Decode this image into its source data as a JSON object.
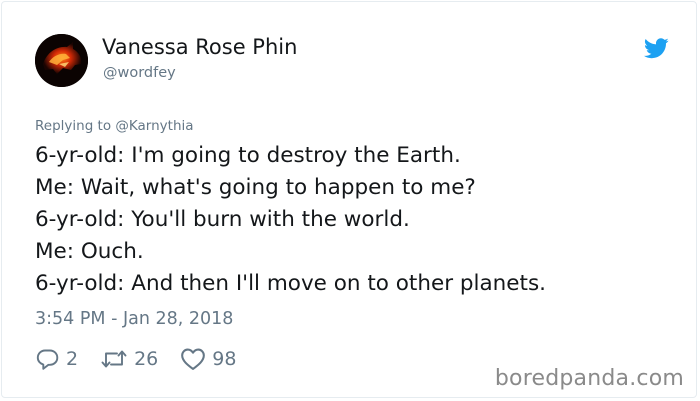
{
  "author": {
    "name": "Vanessa Rose Phin",
    "handle": "@wordfey",
    "avatar": "red-wolf-avatar"
  },
  "reply": {
    "prefix": "Replying to ",
    "mention": "@Karnythia"
  },
  "tweet": {
    "lines": [
      "6-yr-old: I'm going to destroy the Earth.",
      "Me: Wait, what's going to happen to me?",
      "6-yr-old: You'll burn with the world.",
      "Me: Ouch.",
      "6-yr-old: And then I'll move on to other planets."
    ],
    "timestamp": "3:54 PM - Jan 28, 2018"
  },
  "actions": {
    "replies": "2",
    "retweets": "26",
    "likes": "98"
  },
  "watermark": "boredpanda.com",
  "colors": {
    "twitter_blue": "#1da1f2",
    "muted_text": "#657786",
    "main_text": "#14171a"
  },
  "icons": {
    "brand": "twitter-bird-icon",
    "reply": "reply-icon",
    "retweet": "retweet-icon",
    "like": "heart-icon"
  }
}
